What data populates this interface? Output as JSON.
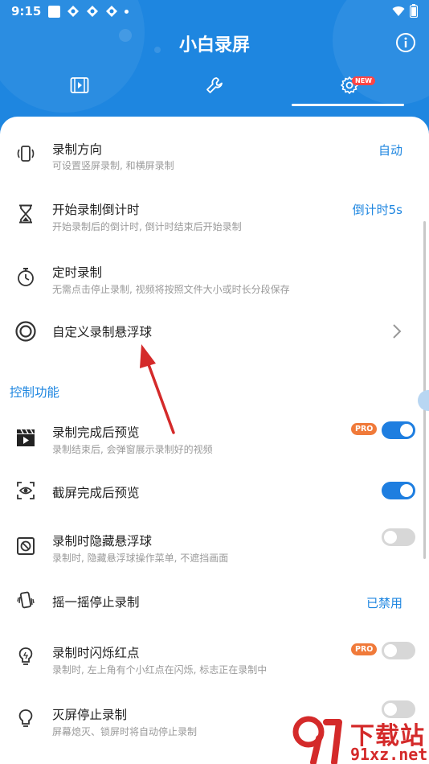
{
  "status_bar": {
    "time": "9:15"
  },
  "app": {
    "title": "小白录屏"
  },
  "tabs": {
    "items": [
      {
        "icon": "video-icon"
      },
      {
        "icon": "wrench-icon"
      },
      {
        "icon": "gear-icon",
        "badge": "NEW",
        "selected": true
      }
    ]
  },
  "settings": [
    {
      "title": "录制方向",
      "subtitle": "可设置竖屏录制, 和横屏录制",
      "value": "自动",
      "icon": "phone-rotate-icon"
    },
    {
      "title": "开始录制倒计时",
      "subtitle": "开始录制后的倒计时, 倒计时结束后开始录制",
      "value": "倒计时5s",
      "icon": "hourglass-icon"
    },
    {
      "title": "定时录制",
      "subtitle": "无需点击停止录制, 视频将按照文件大小或时长分段保存",
      "icon": "stopwatch-icon"
    },
    {
      "title": "自定义录制悬浮球",
      "icon": "floating-ball-icon",
      "chevron": true
    }
  ],
  "section_control": {
    "label": "控制功能"
  },
  "controls": [
    {
      "title": "录制完成后预览",
      "subtitle": "录制结束后, 会弹窗展示录制好的视频",
      "pro": "PRO",
      "toggle": true,
      "icon": "clapperboard-icon"
    },
    {
      "title": "截屏完成后预览",
      "toggle": true,
      "icon": "screenshot-eye-icon"
    },
    {
      "title": "录制时隐藏悬浮球",
      "subtitle": "录制时, 隐藏悬浮球操作菜单, 不遮挡画面",
      "toggle": false,
      "icon": "hide-ball-icon"
    },
    {
      "title": "摇一摇停止录制",
      "value": "已禁用",
      "icon": "shake-phone-icon"
    },
    {
      "title": "录制时闪烁红点",
      "subtitle": "录制时, 左上角有个小红点在闪烁, 标志正在录制中",
      "pro": "PRO",
      "toggle": false,
      "icon": "bulb-icon"
    },
    {
      "title": "灭屏停止录制",
      "subtitle": "屏幕熄灭、锁屏时将自动停止录制",
      "toggle": false,
      "icon": "bulb-outline-icon"
    }
  ],
  "watermark": {
    "brand": "下载站",
    "domain": "91xz.net"
  },
  "colors": {
    "primary": "#1e86e0",
    "pro": "#f07a3a",
    "arrow": "#d42a2a"
  }
}
